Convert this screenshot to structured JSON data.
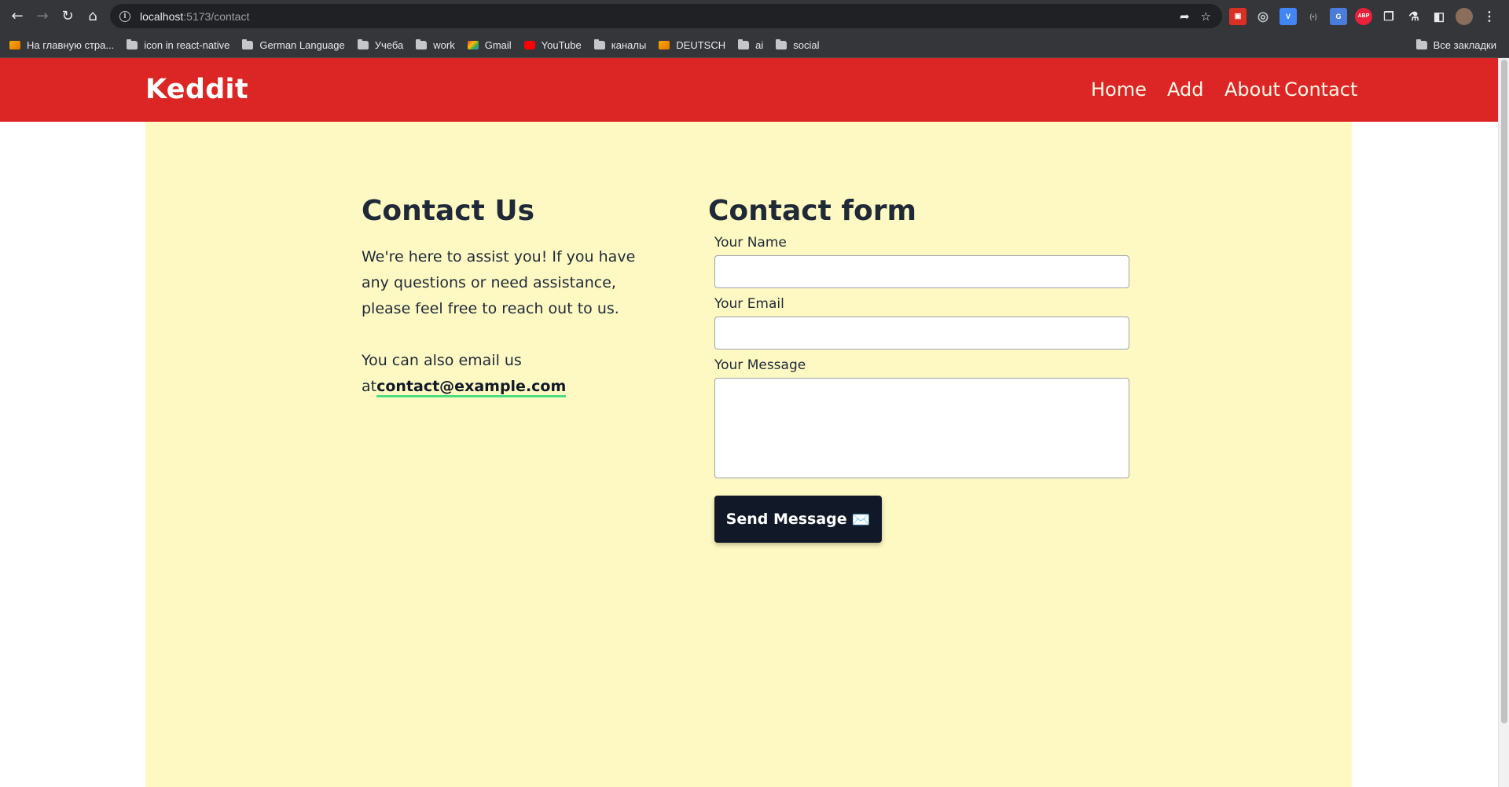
{
  "browser": {
    "url_host": "localhost",
    "url_path": ":5173/contact",
    "bookmarks": [
      {
        "label": "На главную стра...",
        "icon": "site-icon"
      },
      {
        "label": "icon in react-native",
        "icon": "folder-icon"
      },
      {
        "label": "German Language",
        "icon": "folder-icon"
      },
      {
        "label": "Учеба",
        "icon": "folder-icon"
      },
      {
        "label": "work",
        "icon": "folder-icon"
      },
      {
        "label": "Gmail",
        "icon": "gmail-icon"
      },
      {
        "label": "YouTube",
        "icon": "youtube-icon"
      },
      {
        "label": "каналы",
        "icon": "folder-icon"
      },
      {
        "label": "DEUTSCH",
        "icon": "site-icon"
      },
      {
        "label": "ai",
        "icon": "folder-icon"
      },
      {
        "label": "social",
        "icon": "folder-icon"
      }
    ],
    "all_bookmarks": "Все закладки"
  },
  "header": {
    "logo": "Keddit",
    "nav": [
      "Home",
      "Add",
      "About",
      "Contact"
    ]
  },
  "contact": {
    "title": "Contact Us",
    "intro": "We're here to assist you! If you have any questions or need assistance, please feel free to reach out to us.",
    "email_prefix": "You can also email us at",
    "email": "contact@example.com"
  },
  "form": {
    "title": "Contact form",
    "name_label": "Your Name",
    "email_label": "Your Email",
    "message_label": "Your Message",
    "name_value": "",
    "email_value": "",
    "message_value": "",
    "submit_label": "Send Message",
    "submit_emoji": "✉️"
  },
  "colors": {
    "header_bg": "#dc2626",
    "main_bg": "#fef9c3",
    "button_bg": "#111827",
    "link_underline": "#4ade80"
  }
}
